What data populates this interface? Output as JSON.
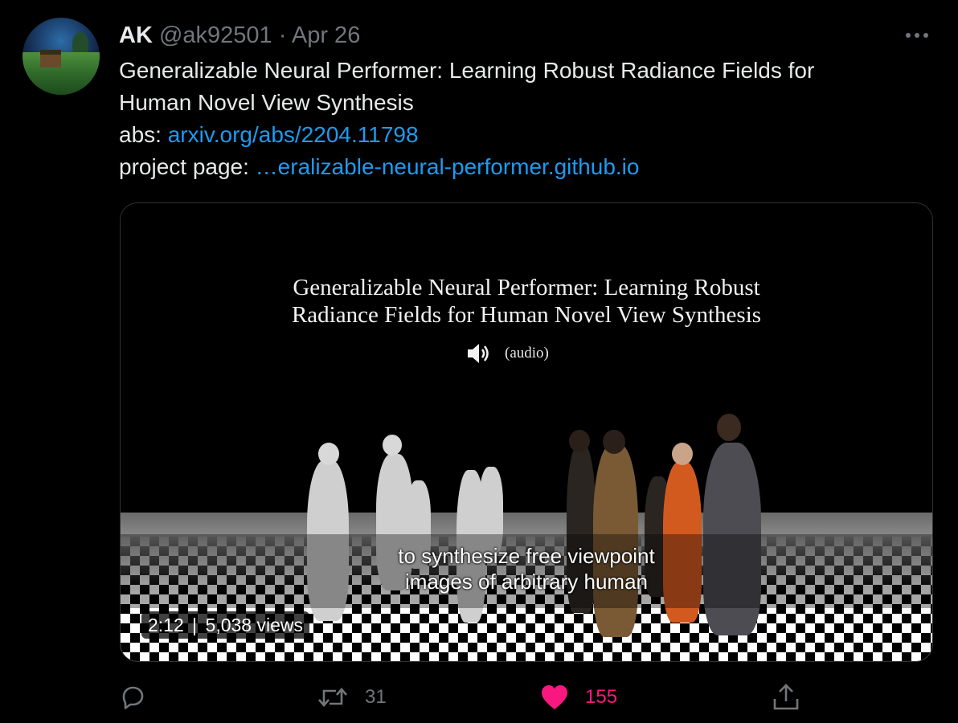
{
  "author": {
    "name": "AK",
    "handle": "@ak92501",
    "separator": "·",
    "date": "Apr 26"
  },
  "tweet": {
    "line1": "Generalizable Neural Performer: Learning Robust Radiance Fields for",
    "line2": "Human Novel View Synthesis",
    "abs_label": "abs:",
    "abs_link": "arxiv.org/abs/2204.11798",
    "project_label": "project page:",
    "project_link": "…eralizable-neural-performer.github.io"
  },
  "video": {
    "title_line1": "Generalizable Neural Performer: Learning Robust",
    "title_line2": "Radiance Fields for Human Novel View Synthesis",
    "audio_label": "(audio)",
    "caption_line1": "to synthesize free viewpoint",
    "caption_line2": "images of arbitrary human",
    "duration": "2:12",
    "views": "5,038 views"
  },
  "actions": {
    "reply_count": "",
    "retweet_count": "31",
    "like_count": "155"
  },
  "colors": {
    "background": "#000000",
    "link": "#1d9bf0",
    "like": "#f91880",
    "muted": "#71767b"
  }
}
